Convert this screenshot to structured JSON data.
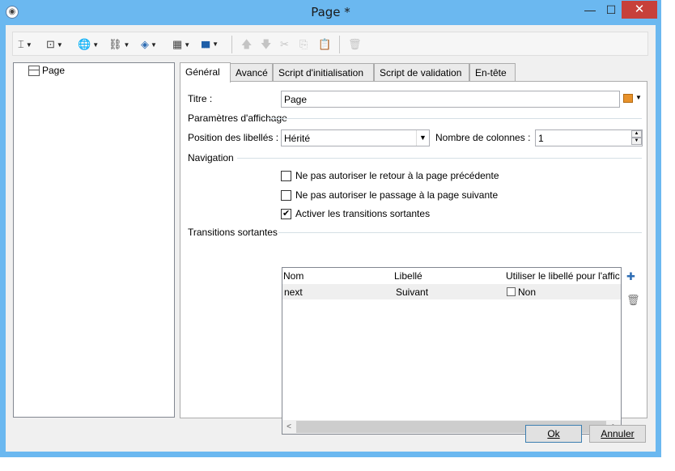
{
  "window": {
    "title": "Page *",
    "app_icon": "◉",
    "minimize": "—",
    "maximize": "☐",
    "close": "✕"
  },
  "toolbar": {
    "items": [
      {
        "icon": "text-cursor-icon",
        "glyph": "⌶"
      },
      {
        "icon": "form-field-icon",
        "glyph": "⊡"
      },
      {
        "icon": "globe-icon",
        "glyph": "🌐"
      },
      {
        "icon": "link-icon",
        "glyph": "⛓"
      },
      {
        "icon": "layers-icon",
        "glyph": "◈"
      },
      {
        "icon": "table-icon",
        "glyph": "▦"
      },
      {
        "icon": "columns-icon",
        "glyph": "▮▮▮"
      },
      {
        "icon": "move-up-icon",
        "glyph": "🡅"
      },
      {
        "icon": "move-down-icon",
        "glyph": "🡇"
      },
      {
        "icon": "cut-icon",
        "glyph": "✂"
      },
      {
        "icon": "copy-icon",
        "glyph": "⎘"
      },
      {
        "icon": "paste-icon",
        "glyph": "📋"
      },
      {
        "icon": "delete-icon",
        "glyph": "🗑"
      }
    ],
    "dropdown_arrow": "▼"
  },
  "tree": {
    "item_label": "Page"
  },
  "tabs": [
    "Général",
    "Avancé",
    "Script d'initialisation",
    "Script de validation",
    "En-tête"
  ],
  "form": {
    "titre_label": "Titre :",
    "titre_value": "Page",
    "display_group": "Paramètres d'affichage",
    "position_label": "Position des libellés :",
    "position_value": "Hérité",
    "columns_label": "Nombre de colonnes :",
    "columns_value": "1",
    "navigation_group": "Navigation",
    "checkboxes": [
      {
        "label": "Ne pas autoriser le retour à la page précédente",
        "checked": false
      },
      {
        "label": "Ne pas autoriser le passage à la page suivante",
        "checked": false
      },
      {
        "label": "Activer les transitions sortantes",
        "checked": true
      }
    ],
    "transitions_group": "Transitions sortantes"
  },
  "grid": {
    "columns": [
      "Nom",
      "Libellé",
      "Utiliser le libellé pour l'affic"
    ],
    "rows": [
      {
        "nom": "next",
        "libelle": "Suivant",
        "use_label": "Non",
        "use_label_checked": false
      }
    ],
    "scroll_left": "<",
    "scroll_right": ">"
  },
  "side_buttons": {
    "add": "✚",
    "delete": "🗑"
  },
  "buttons": {
    "ok": "Ok",
    "cancel": "Annuler"
  },
  "colors": {
    "title_bar": "#6bb8f0",
    "close_button": "#c7403a",
    "row_highlight": "#efefef"
  }
}
